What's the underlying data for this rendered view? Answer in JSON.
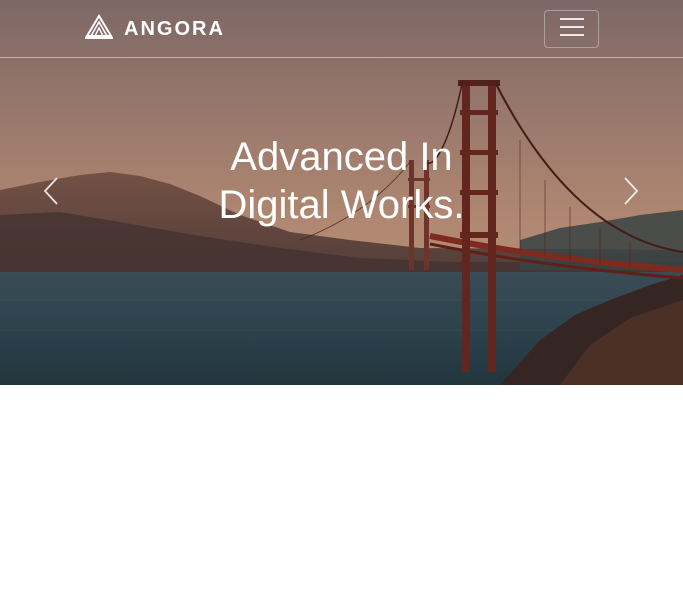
{
  "navbar": {
    "brand_name": "ANGORA",
    "brand_icon": "angora-logo-icon",
    "menu_icon": "hamburger-menu-icon"
  },
  "hero": {
    "headline_line1": "Advanced In",
    "headline_line2": "Digital Works.",
    "prev_icon": "chevron-left-icon",
    "next_icon": "chevron-right-icon",
    "image_subject": "bridge-over-bay"
  },
  "colors": {
    "text": "#ffffff",
    "background": "#ffffff"
  }
}
